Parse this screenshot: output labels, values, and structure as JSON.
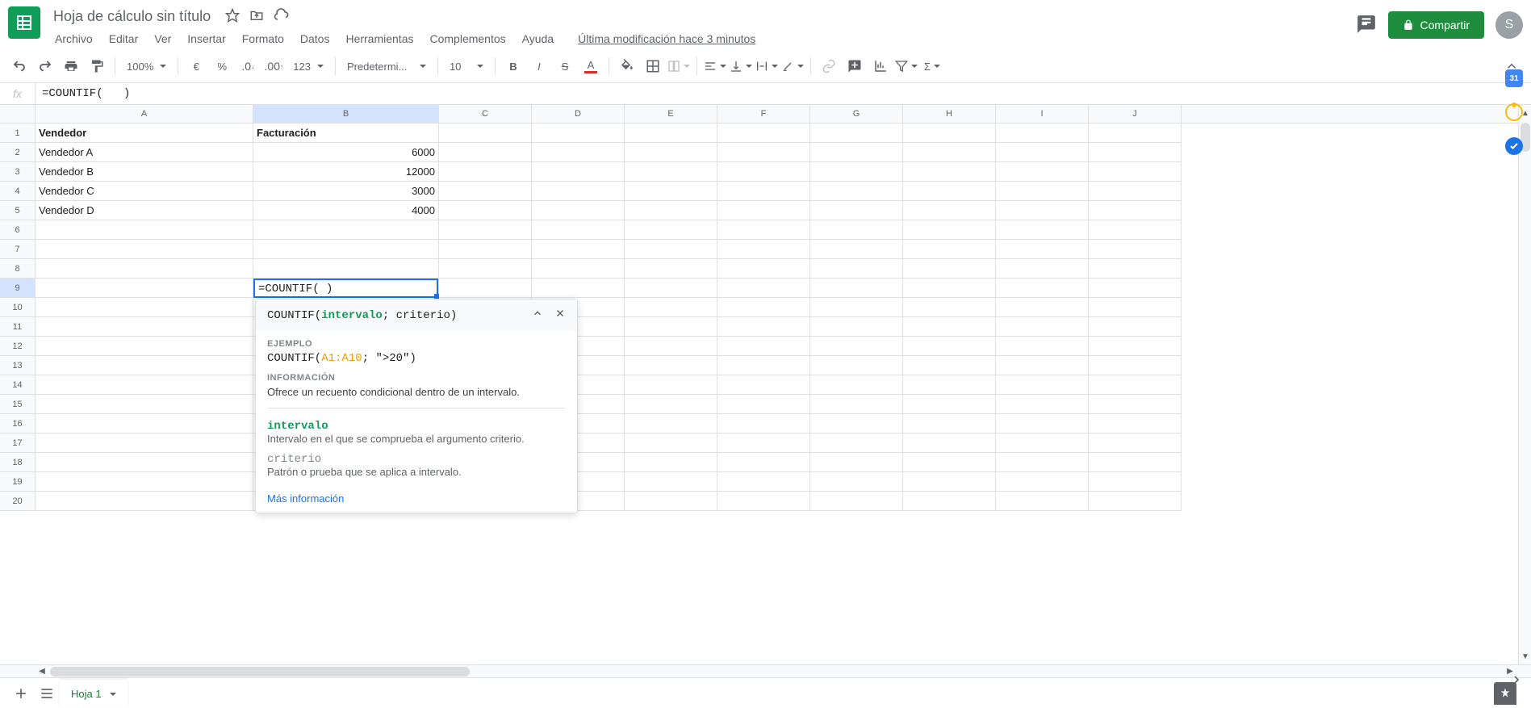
{
  "doc": {
    "title": "Hoja de cálculo sin título",
    "last_modified": "Última modificación hace 3 minutos"
  },
  "menubar": [
    "Archivo",
    "Editar",
    "Ver",
    "Insertar",
    "Formato",
    "Datos",
    "Herramientas",
    "Complementos",
    "Ayuda"
  ],
  "share": {
    "label": "Compartir"
  },
  "avatar": {
    "initial": "S"
  },
  "toolbar": {
    "zoom": "100%",
    "font": "Predetermi...",
    "font_size": "10",
    "decimal_format": "123"
  },
  "formula_bar": {
    "value": "=COUNTIF(   )"
  },
  "columns": [
    "A",
    "B",
    "C",
    "D",
    "E",
    "F",
    "G",
    "H",
    "I",
    "J"
  ],
  "rows_count": 20,
  "active_cell": {
    "row": 9,
    "col": "B",
    "value": "=COUNTIF(   )"
  },
  "data": {
    "headers": {
      "A": "Vendedor",
      "B": "Facturación"
    },
    "rows": [
      {
        "A": "Vendedor A",
        "B": "6000"
      },
      {
        "A": "Vendedor B",
        "B": "12000"
      },
      {
        "A": "Vendedor C",
        "B": "3000"
      },
      {
        "A": "Vendedor D",
        "B": "4000"
      }
    ]
  },
  "tooltip": {
    "signature_fn": "COUNTIF(",
    "signature_p1": "intervalo",
    "signature_mid": "; criterio)",
    "example_label": "EJEMPLO",
    "example_fn": "COUNTIF(",
    "example_range": "A1:A10",
    "example_rest": "; \">20\")",
    "info_label": "INFORMACIÓN",
    "info_text": "Ofrece un recuento condicional dentro de un intervalo.",
    "param1_name": "intervalo",
    "param1_desc": "Intervalo en el que se comprueba el argumento criterio.",
    "param2_name": "criterio",
    "param2_desc": "Patrón o prueba que se aplica a intervalo.",
    "more_info": "Más información"
  },
  "sheet_tab": {
    "name": "Hoja 1"
  },
  "side": {
    "calendar": "31"
  }
}
